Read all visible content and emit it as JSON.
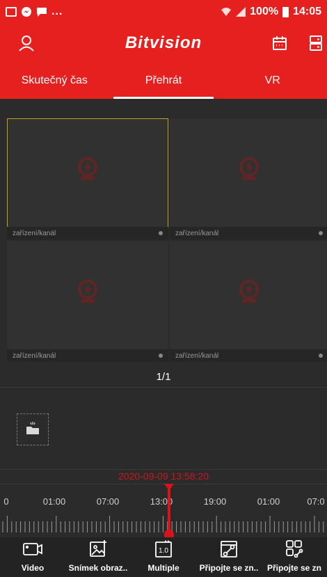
{
  "status_bar": {
    "overflow": "...",
    "battery": "100%",
    "time": "14:05"
  },
  "header": {
    "title": "Bitvision",
    "profile_icon": "person-icon",
    "calendar_icon": "calendar-icon",
    "device_icon": "device-list-icon"
  },
  "tabs": [
    {
      "label": "Skutečný čas",
      "active": false
    },
    {
      "label": "Přehrát",
      "active": true
    },
    {
      "label": "VR",
      "active": false
    }
  ],
  "grid": {
    "cells": [
      {
        "label": "zařízení/kanál",
        "selected": true
      },
      {
        "label": "zařízení/kanál",
        "selected": false
      },
      {
        "label": "zařízení/kanál",
        "selected": false
      },
      {
        "label": "zařízení/kanál",
        "selected": false
      }
    ],
    "pager": "1/1"
  },
  "timeline": {
    "datetime": "2020-09-09 13:58:20",
    "labels": [
      "0",
      "01:00",
      "07:00",
      "13:00",
      "19:00",
      "01:00",
      "07:0"
    ]
  },
  "toolbar": {
    "items": [
      {
        "label": "Video",
        "icon": "video-camera-icon"
      },
      {
        "label": "Snímek obraz..",
        "icon": "snapshot-icon"
      },
      {
        "label": "Multiple",
        "icon": "speed-icon"
      },
      {
        "label": "Připojte se zn..",
        "icon": "link-icon"
      },
      {
        "label": "Připojte se zn",
        "icon": "multi-link-icon"
      }
    ],
    "speed_value": "1.0"
  },
  "colors": {
    "brand": "#e5201f",
    "timeline_accent": "#d9141b",
    "selected_border": "#b9a51c"
  }
}
